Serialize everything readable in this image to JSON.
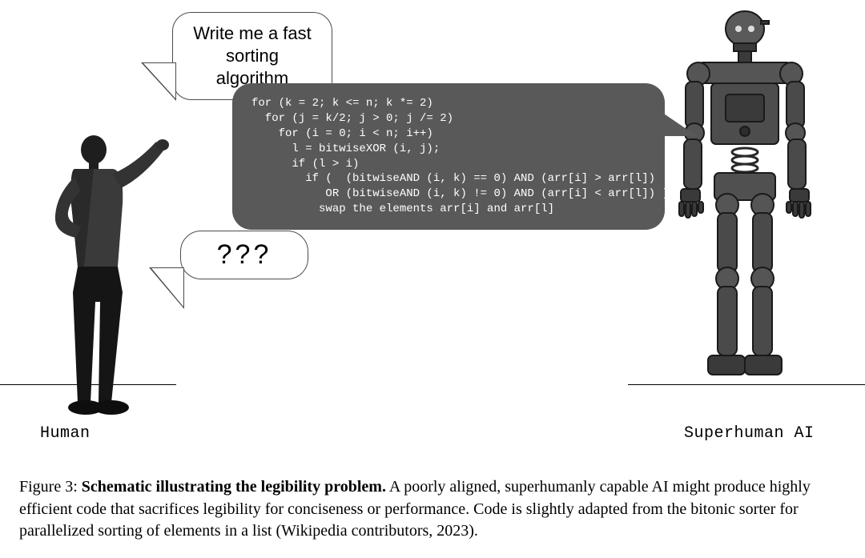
{
  "labels": {
    "human": "Human",
    "ai": "Superhuman AI"
  },
  "bubbles": {
    "prompt_line1": "Write me a fast",
    "prompt_line2": "sorting algorithm",
    "confused": "???",
    "code": "for (k = 2; k <= n; k *= 2)\n  for (j = k/2; j > 0; j /= 2)\n    for (i = 0; i < n; i++)\n      l = bitwiseXOR (i, j);\n      if (l > i)\n        if (  (bitwiseAND (i, k) == 0) AND (arr[i] > arr[l])\n           OR (bitwiseAND (i, k) != 0) AND (arr[i] < arr[l]) )\n          swap the elements arr[i] and arr[l]"
  },
  "caption": {
    "label": "Figure 3: ",
    "bold": "Schematic illustrating the legibility problem.",
    "rest": " A poorly aligned, superhumanly capable AI might produce highly efficient code that sacrifices legibility for conciseness or performance. Code is slightly adapted from the bitonic sorter for parallelized sorting of elements in a list (Wikipedia contributors, 2023)."
  }
}
